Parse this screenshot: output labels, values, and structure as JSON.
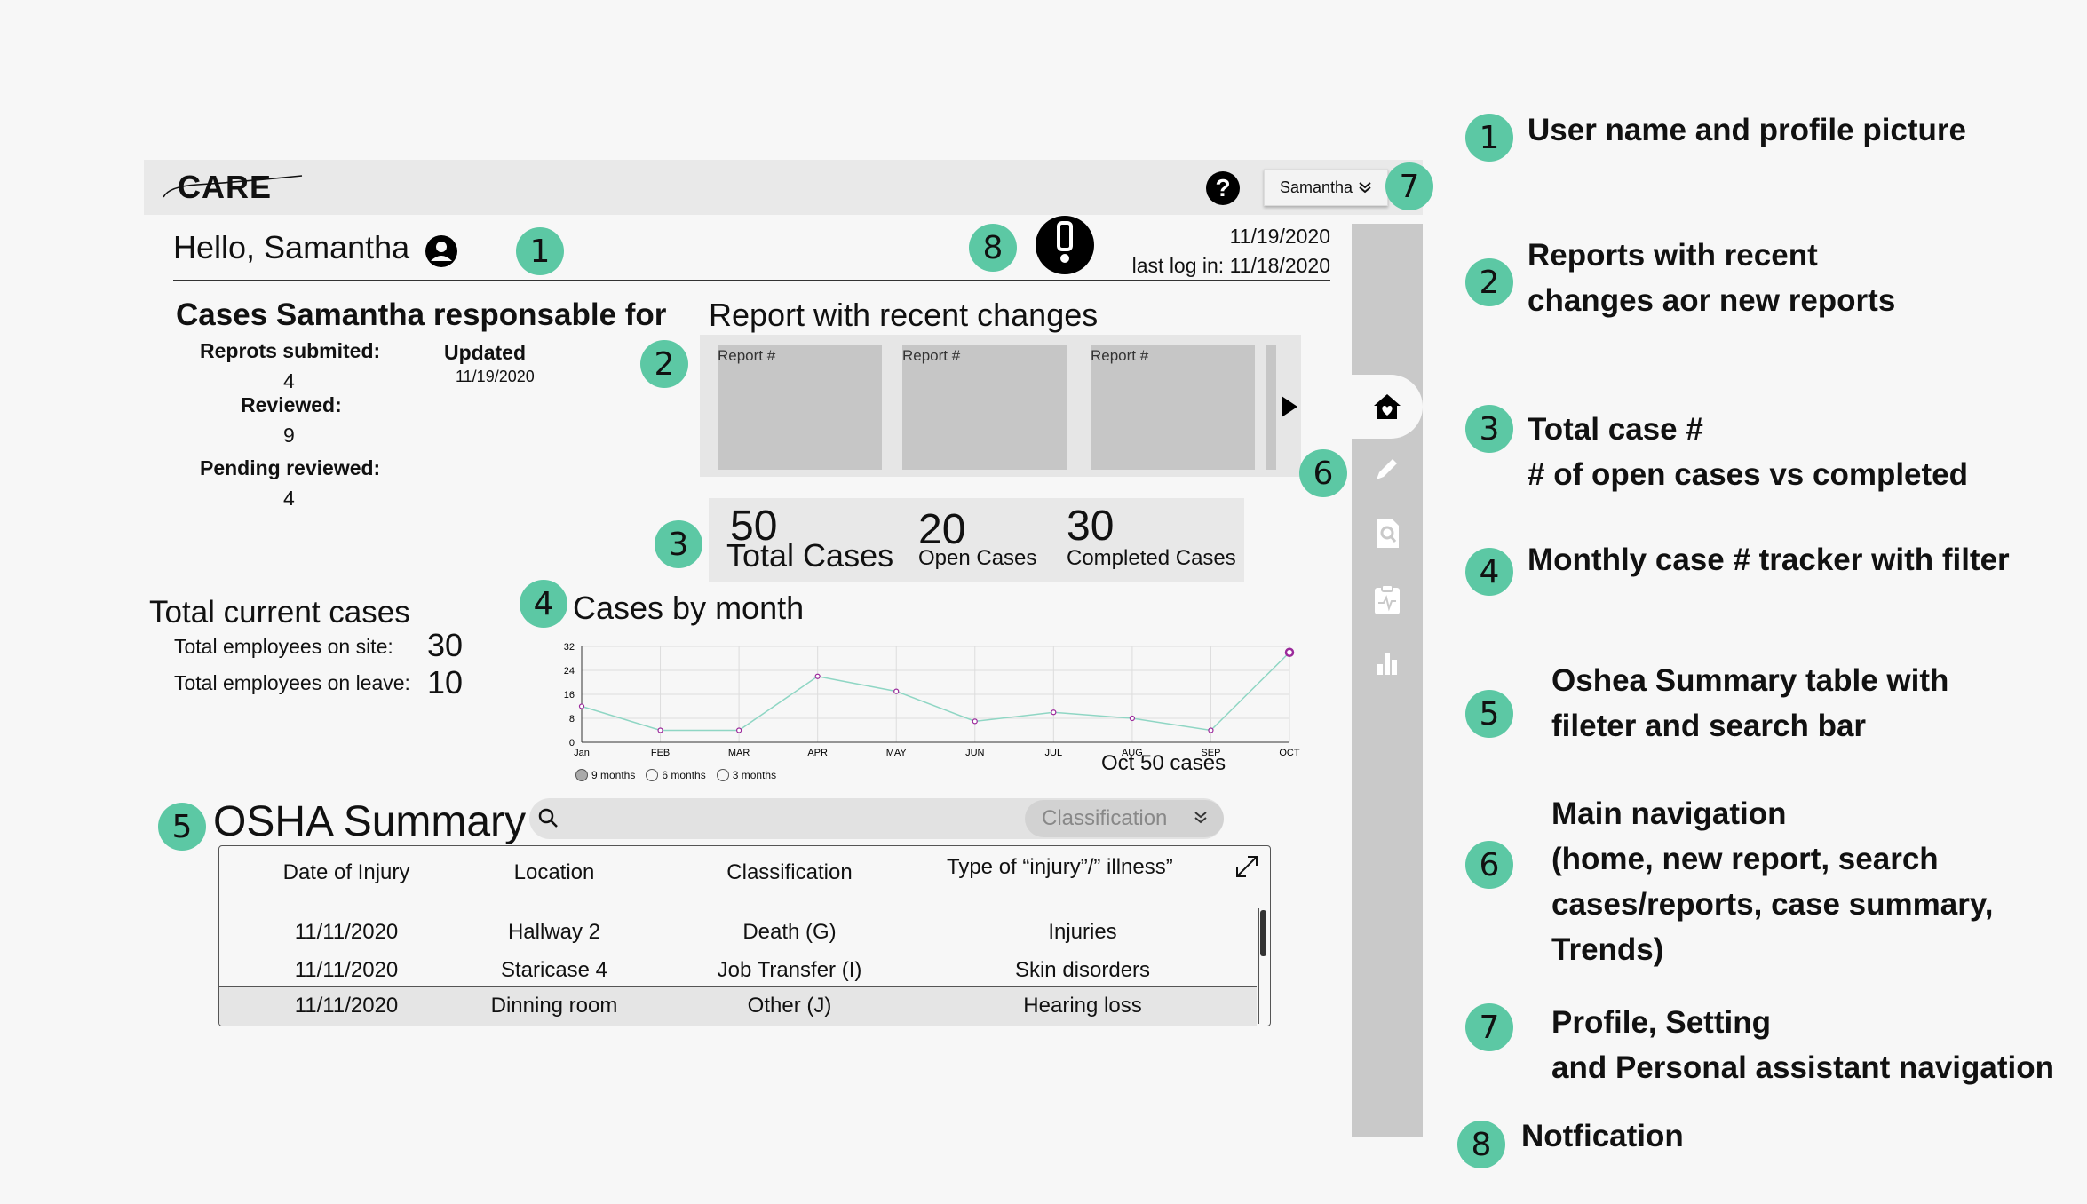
{
  "header": {
    "logo": "CARE",
    "help_icon": "question-icon",
    "user_button": "Samantha"
  },
  "greeting": {
    "text": "Hello, Samantha",
    "date": "11/19/2020",
    "last_login": "last log in: 11/18/2020"
  },
  "cases_resp": {
    "title": "Cases Samantha responsable for",
    "submitted_label": "Reprots submited:",
    "submitted_value": "4",
    "updated_label": "Updated",
    "updated_value": "11/19/2020",
    "reviewed_label": "Reviewed:",
    "reviewed_value": "9",
    "pending_label": "Pending reviewed:",
    "pending_value": "4"
  },
  "recent_reports": {
    "title": "Report  with recent changes",
    "cards": [
      "Report #",
      "Report #",
      "Report #"
    ]
  },
  "stats": {
    "total_value": "50",
    "total_label": "Total Cases",
    "open_value": "20",
    "open_label": "Open Cases",
    "completed_value": "30",
    "completed_label": "Completed Cases"
  },
  "current": {
    "title": "Total current cases",
    "on_site_label": "Total employees on site:",
    "on_site_value": "30",
    "on_leave_label": "Total employees on leave:",
    "on_leave_value": "10"
  },
  "chart_section": {
    "title": "Cases by month",
    "filters": [
      "9 months",
      "6 months",
      "3 months"
    ],
    "selected_filter": "9 months",
    "highlight_label": "Oct 50 cases"
  },
  "chart_data": {
    "type": "line",
    "categories": [
      "Jan",
      "FEB",
      "MAR",
      "APR",
      "MAY",
      "JUN",
      "JUL",
      "AUG",
      "SEP",
      "OCT"
    ],
    "series": [
      {
        "values": [
          12,
          4,
          4,
          22,
          17,
          7,
          10,
          8,
          4,
          30
        ]
      }
    ],
    "ylim": [
      0,
      32
    ],
    "yticks": [
      "32",
      "24",
      "16",
      "8",
      "0"
    ],
    "grid": true,
    "line_color": "#8fd6c4",
    "point_color": "#9b2a9b"
  },
  "osha": {
    "title": "OSHA Summary",
    "classification_placeholder": "Classification",
    "columns": [
      "Date of Injury",
      "Location",
      "Classification",
      "Type of “injury”/” illness”"
    ],
    "rows": [
      [
        "11/11/2020",
        "Hallway 2",
        "Death (G)",
        "Injuries"
      ],
      [
        "11/11/2020",
        "Staricase 4",
        "Job Transfer (I)",
        "Skin disorders"
      ],
      [
        "11/11/2020",
        "Dinning room",
        "Other (J)",
        "Hearing loss"
      ]
    ]
  },
  "badges": [
    "1",
    "2",
    "3",
    "4",
    "5",
    "6",
    "7",
    "8"
  ],
  "legend": [
    {
      "num": "1",
      "lines": [
        "User name and profile picture"
      ]
    },
    {
      "num": "2",
      "lines": [
        "Reports with recent",
        "changes aor  new reports"
      ]
    },
    {
      "num": "3",
      "lines": [
        "Total case #",
        "# of open cases vs completed"
      ]
    },
    {
      "num": "4",
      "lines": [
        "Monthly case  # tracker with filter"
      ]
    },
    {
      "num": "5",
      "lines": [
        "Oshea Summary table with",
        "fileter and search bar"
      ]
    },
    {
      "num": "6",
      "lines": [
        "Main navigation",
        "(home, new report, search",
        "cases/reports, case summary,",
        "Trends)"
      ]
    },
    {
      "num": "7",
      "lines": [
        "Profile, Setting",
        "and Personal assistant navigation"
      ]
    },
    {
      "num": "8",
      "lines": [
        "Notfication"
      ]
    }
  ],
  "colors": {
    "badge": "#5cc8a4",
    "sidebar": "#c9c9c9",
    "card": "#c6c6c6"
  }
}
